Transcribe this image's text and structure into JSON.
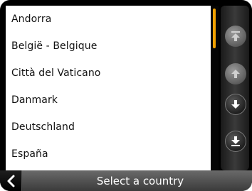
{
  "list": {
    "items": [
      "Andorra",
      "België - Belgique",
      "Città del Vaticano",
      "Danmark",
      "Deutschland",
      "España"
    ]
  },
  "scroll": {
    "position_fraction": 0.0,
    "thumb_color": "#f0a000"
  },
  "buttons": {
    "top": {
      "icon": "double-up-arrow-icon",
      "enabled": false
    },
    "up": {
      "icon": "up-arrow-icon",
      "enabled": false
    },
    "down": {
      "icon": "down-arrow-icon",
      "enabled": true
    },
    "bottom": {
      "icon": "double-down-arrow-icon",
      "enabled": true
    }
  },
  "footer": {
    "title": "Select a country",
    "back_icon": "chevron-left-icon"
  }
}
